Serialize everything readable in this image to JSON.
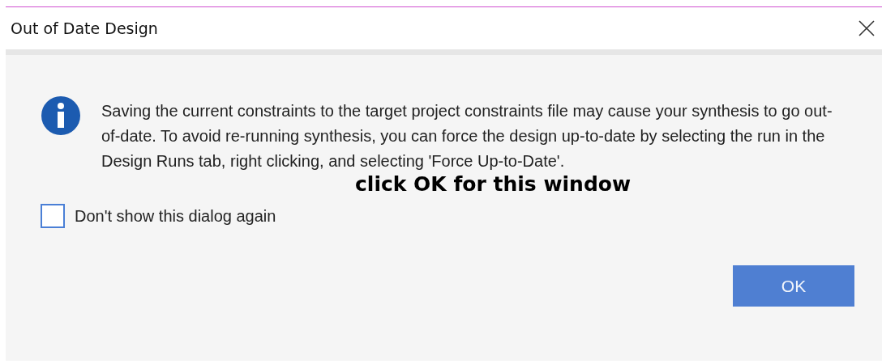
{
  "window": {
    "title": "Out of Date Design"
  },
  "message": "Saving the current constraints to the target project constraints file may cause your synthesis to go out-of-date. To avoid re-running synthesis, you can force the design up-to-date by selecting the run in the Design Runs tab, right clicking, and selecting 'Force Up-to-Date'.",
  "annotation": "click OK for this window",
  "checkbox": {
    "label": "Don't show this dialog again",
    "checked": false
  },
  "buttons": [
    "OK"
  ]
}
